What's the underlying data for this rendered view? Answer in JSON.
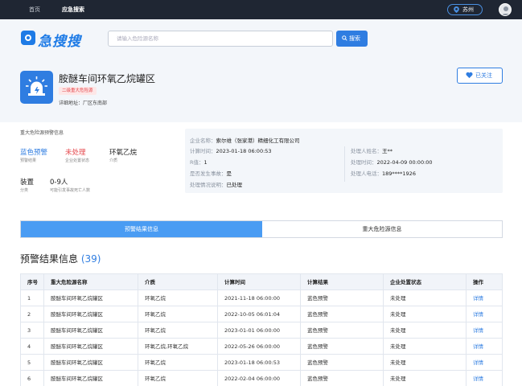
{
  "nav": {
    "items": [
      "首页",
      "应急搜索"
    ],
    "city": "苏州"
  },
  "header": {
    "logo_text": "急搜搜",
    "search_placeholder": "请输入危险源名称",
    "search_button": "搜索"
  },
  "entity": {
    "title": "胺醚车间环氧乙烷罐区",
    "tag": "二级重大危险源",
    "address": "详细地址：厂区东南部",
    "follow_button": "已关注"
  },
  "summary": {
    "heading": "重大危险源预警信息",
    "stats": [
      {
        "value": "蓝色预警",
        "label": "预警结果",
        "color": "#2f7de1"
      },
      {
        "value": "未处理",
        "label": "企业处置状态",
        "color": "#e5484d"
      },
      {
        "value": "环氧乙烷",
        "label": "介质",
        "color": "#222222"
      },
      {
        "value": "装置",
        "label": "分类",
        "color": "#222222"
      },
      {
        "value": "0-9人",
        "label": "可能引发事故死亡人数",
        "color": "#222222"
      }
    ]
  },
  "detail": {
    "left": [
      {
        "key": "企业名称：",
        "value": "索尔维（张家港）精细化工有限公司"
      },
      {
        "key": "计算时间：",
        "value": "2023-01-18 06:00:53"
      },
      {
        "key": "R值：",
        "value": "1"
      },
      {
        "key": "是否发生事故：",
        "value": "是"
      },
      {
        "key": "处理情况说明：",
        "value": "已处理"
      }
    ],
    "right": [
      {
        "key": "处理人姓名：",
        "value": "王**"
      },
      {
        "key": "处理时间：",
        "value": "2022-04-09 00:00:00"
      },
      {
        "key": "处理人电话：",
        "value": "189****1926"
      }
    ]
  },
  "tabs": [
    "预警结果信息",
    "重大危险源信息"
  ],
  "results": {
    "title": "预警结果信息",
    "count": "(39)",
    "columns": [
      "序号",
      "重大危险源名称",
      "介质",
      "计算时间",
      "计算结果",
      "企业处置状态",
      "操作"
    ],
    "rows": [
      [
        "1",
        "胺醚车间环氧乙烷罐区",
        "环氧乙烷",
        "2021-11-18 06:00:00",
        "蓝色预警",
        "未处理",
        "详情"
      ],
      [
        "2",
        "胺醚车间环氧乙烷罐区",
        "环氧乙烷",
        "2022-10-05 06:01:04",
        "蓝色预警",
        "未处理",
        "详情"
      ],
      [
        "3",
        "胺醚车间环氧乙烷罐区",
        "环氧乙烷",
        "2023-01-01 06:00:00",
        "蓝色预警",
        "未处理",
        "详情"
      ],
      [
        "4",
        "胺醚车间环氧乙烷罐区",
        "环氧乙烷,环氧乙烷",
        "2022-05-26 06:00:00",
        "蓝色预警",
        "未处理",
        "详情"
      ],
      [
        "5",
        "胺醚车间环氧乙烷罐区",
        "环氧乙烷",
        "2023-01-18 06:00:53",
        "蓝色预警",
        "未处理",
        "详情"
      ],
      [
        "6",
        "胺醚车间环氧乙烷罐区",
        "环氧乙烷",
        "2022-02-04 06:00:00",
        "蓝色预警",
        "未处理",
        "详情"
      ]
    ]
  }
}
